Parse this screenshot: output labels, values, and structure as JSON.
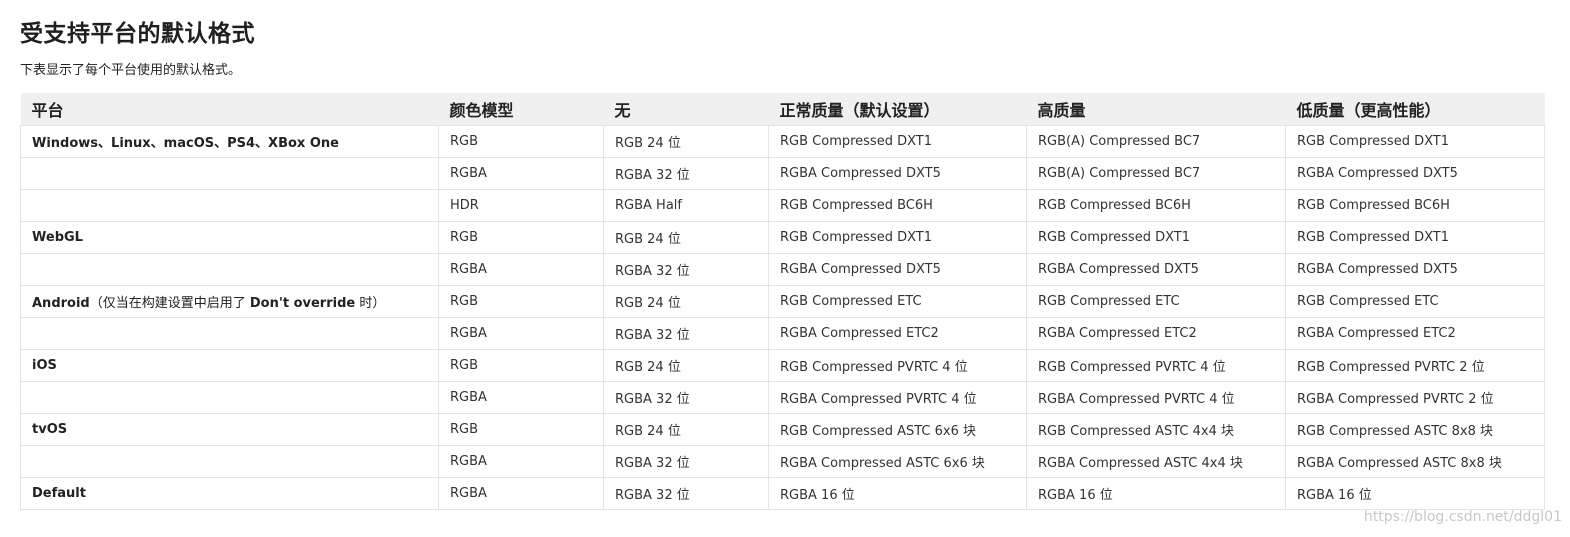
{
  "title": "受支持平台的默认格式",
  "intro": "下表显示了每个平台使用的默认格式。",
  "table": {
    "headers": [
      "平台",
      "颜色模型",
      "无",
      "正常质量（默认设置）",
      "高质量",
      "低质量（更高性能）"
    ],
    "rows": [
      {
        "platform": "Windows、Linux、macOS、PS4、XBox One",
        "cells": [
          "RGB",
          "RGB 24 位",
          "RGB Compressed DXT1",
          "RGB(A) Compressed BC7",
          "RGB Compressed DXT1"
        ]
      },
      {
        "platform": "",
        "cells": [
          "RGBA",
          "RGBA 32 位",
          "RGBA Compressed DXT5",
          "RGB(A) Compressed BC7",
          "RGBA Compressed DXT5"
        ]
      },
      {
        "platform": "",
        "cells": [
          "HDR",
          "RGBA Half",
          "RGB Compressed BC6H",
          "RGB Compressed BC6H",
          "RGB Compressed BC6H"
        ]
      },
      {
        "platform": "WebGL",
        "cells": [
          "RGB",
          "RGB 24 位",
          "RGB Compressed DXT1",
          "RGB Compressed DXT1",
          "RGB Compressed DXT1"
        ]
      },
      {
        "platform": "",
        "cells": [
          "RGBA",
          "RGBA 32 位",
          "RGBA Compressed DXT5",
          "RGBA Compressed DXT5",
          "RGBA Compressed DXT5"
        ]
      },
      {
        "platform": "Android",
        "platform_note_pre": "（仅当在构建设置中启用了 ",
        "platform_note_kw": "Don't override",
        "platform_note_post": " 时）",
        "cells": [
          "RGB",
          "RGB 24 位",
          "RGB Compressed ETC",
          "RGB Compressed ETC",
          "RGB Compressed ETC"
        ]
      },
      {
        "platform": "",
        "cells": [
          "RGBA",
          "RGBA 32 位",
          "RGBA Compressed ETC2",
          "RGBA Compressed ETC2",
          "RGBA Compressed ETC2"
        ]
      },
      {
        "platform": "iOS",
        "cells": [
          "RGB",
          "RGB 24 位",
          "RGB Compressed PVRTC 4 位",
          "RGB Compressed PVRTC 4 位",
          "RGB Compressed PVRTC 2 位"
        ]
      },
      {
        "platform": "",
        "cells": [
          "RGBA",
          "RGBA 32 位",
          "RGBA Compressed PVRTC 4 位",
          "RGBA Compressed PVRTC 4 位",
          "RGBA Compressed PVRTC 2 位"
        ]
      },
      {
        "platform": "tvOS",
        "cells": [
          "RGB",
          "RGB 24 位",
          "RGB Compressed ASTC 6x6 块",
          "RGB Compressed ASTC 4x4 块",
          "RGB Compressed ASTC 8x8 块"
        ]
      },
      {
        "platform": "",
        "cells": [
          "RGBA",
          "RGBA 32 位",
          "RGBA Compressed ASTC 6x6 块",
          "RGBA Compressed ASTC 4x4 块",
          "RGBA Compressed ASTC 8x8 块"
        ]
      },
      {
        "platform": "Default",
        "cells": [
          "RGBA",
          "RGBA 32 位",
          "RGBA 16 位",
          "RGBA 16 位",
          "RGBA 16 位"
        ]
      }
    ]
  },
  "watermark": "https://blog.csdn.net/ddgl01"
}
